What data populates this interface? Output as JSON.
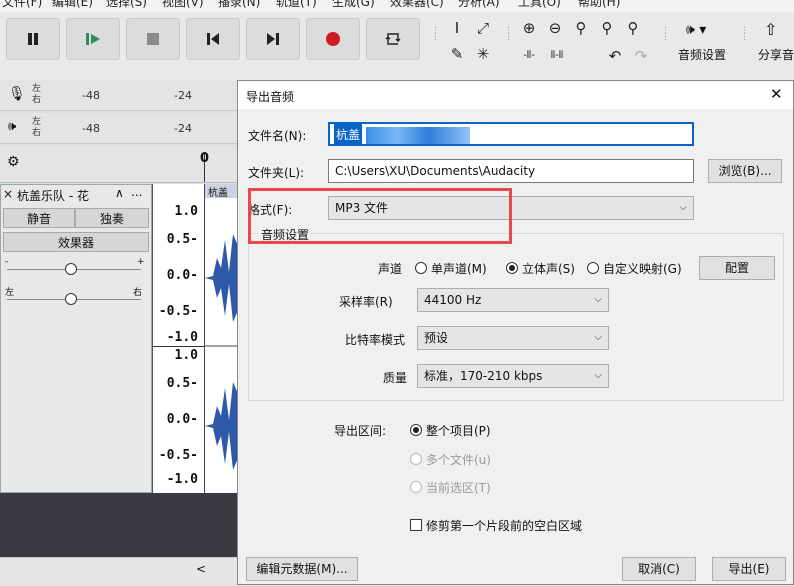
{
  "menu": [
    "文件(F)",
    "编辑(E)",
    "选择(S)",
    "视图(V)",
    "播录(N)",
    "轨道(T)",
    "生成(G)",
    "效果器(C)",
    "分析(A)",
    "工具(O)",
    "帮助(H)"
  ],
  "toolbar": {
    "audio_setup_label": "音频设置",
    "share_audio_label": "分享音"
  },
  "meters": {
    "record": {
      "ch_left": "左",
      "ch_right": "右",
      "ticks": [
        "-48",
        "-24"
      ]
    },
    "play": {
      "ch_left": "左",
      "ch_right": "右",
      "ticks": [
        "-48",
        "-24"
      ]
    }
  },
  "timeline": {
    "zero": "0"
  },
  "track": {
    "name": "杭盖乐队 - 花",
    "more": "...",
    "mute_label": "静音",
    "solo_label": "独奏",
    "effects_label": "效果器",
    "gain_minus": "-",
    "gain_plus": "+",
    "pan_left": "左",
    "pan_right": "右",
    "clip_name": "杭盖"
  },
  "scale": [
    "1.0",
    "0.5-",
    "0.0-",
    "-0.5-",
    "-1.0",
    "1.0",
    "0.5-",
    "0.0-",
    "-0.5-",
    "-1.0"
  ],
  "dialog": {
    "title": "导出音频",
    "filename_label": "文件名(N):",
    "filename_value": "杭盖",
    "folder_label": "文件夹(L):",
    "folder_value": "C:\\Users\\XU\\Documents\\Audacity",
    "browse_label": "浏览(B)...",
    "format_label": "格式(F):",
    "format_value": "MP3 文件",
    "audio_settings_label": "音频设置",
    "channels_label": "声道",
    "channel_options": [
      "单声道(M)",
      "立体声(S)",
      "自定义映射(G)"
    ],
    "channel_selected": "立体声(S)",
    "configure_label": "配置",
    "samplerate_label": "采样率(R)",
    "samplerate_value": "44100 Hz",
    "bitrate_mode_label": "比特率模式",
    "bitrate_mode_value": "预设",
    "quality_label": "质量",
    "quality_value": "标准，170-210 kbps",
    "range_label": "导出区间:",
    "range_options": [
      "整个项目(P)",
      "多个文件(u)",
      "当前选区(T)"
    ],
    "range_selected": "整个项目(P)",
    "trim_label": "修剪第一个片段前的空白区域",
    "edit_metadata_label": "编辑元数据(M)...",
    "cancel_label": "取消(C)",
    "export_label": "导出(E)"
  },
  "colors": {
    "highlight": "#e8474b",
    "selection": "#0a64c8",
    "wave": "#2d59a8",
    "track_bottom": "#3a3a42"
  }
}
